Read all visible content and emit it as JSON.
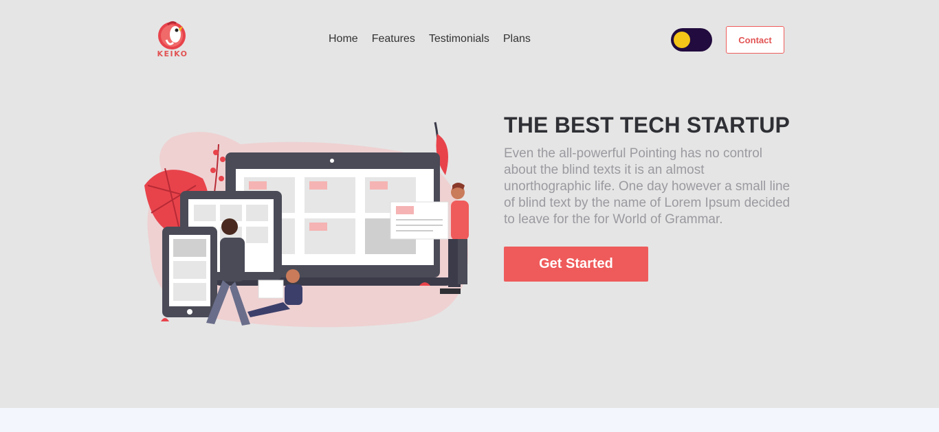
{
  "brand": {
    "name": "KEIKO"
  },
  "nav": {
    "items": [
      {
        "label": "Home"
      },
      {
        "label": "Features"
      },
      {
        "label": "Testimonials"
      },
      {
        "label": "Plans"
      }
    ]
  },
  "theme_toggle": {
    "state": "off"
  },
  "contact": {
    "label": "Contact"
  },
  "hero": {
    "title": "THE BEST TECH STARTUP",
    "description": "Even the all-powerful Pointing has no control about the blind texts it is an almost unorthographic life. One day however a small line of blind text by the name of Lorem Ipsum decided to leave for the for World of Grammar.",
    "cta_label": "Get Started"
  },
  "colors": {
    "accent": "#ef5b5b",
    "toggle_bg": "#220b3e",
    "toggle_knob": "#f5c518",
    "page_bg": "#e5e5e5"
  }
}
